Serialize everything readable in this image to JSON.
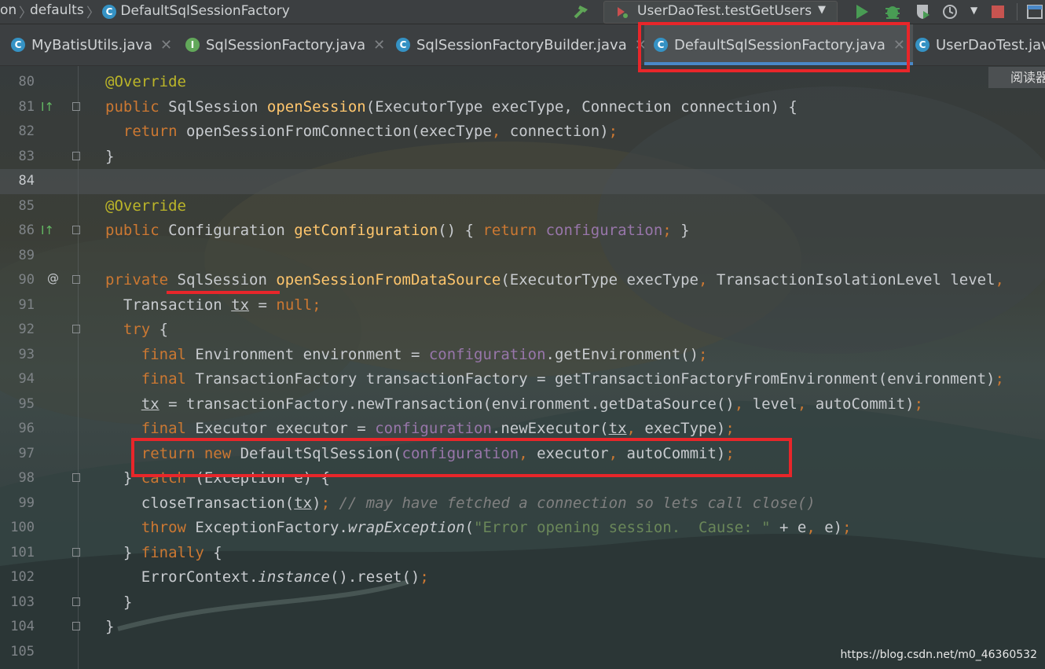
{
  "navbar": {
    "crumb_prefix": "on",
    "crumb_package": "defaults",
    "crumb_class": "DefaultSqlSessionFactory",
    "run_config": "UserDaoTest.testGetUsers"
  },
  "tabs": [
    {
      "label": "MyBatisUtils.java",
      "icon": "C"
    },
    {
      "label": "SqlSessionFactory.java",
      "icon": "I"
    },
    {
      "label": "SqlSessionFactoryBuilder.java",
      "icon": "C"
    },
    {
      "label": "DefaultSqlSessionFactory.java",
      "icon": "C"
    },
    {
      "label": "UserDaoTest.java",
      "icon": "C"
    }
  ],
  "reader_button": "阅读器",
  "editor": {
    "line_numbers": [
      "80",
      "81",
      "82",
      "83",
      "84",
      "85",
      "86",
      "89",
      "90",
      "91",
      "92",
      "93",
      "94",
      "95",
      "96",
      "97",
      "98",
      "99",
      "100",
      "101",
      "102",
      "103",
      "104",
      "105"
    ],
    "gutter_marks": {
      "81": "I↑",
      "86": "I↑",
      "90": "@"
    }
  },
  "watermark": "https://blog.csdn.net/m0_46360532",
  "colors": {
    "keyword": "#cc7832",
    "annotation": "#bbb529",
    "method": "#ffc66d",
    "field": "#9876aa",
    "string": "#6a8759",
    "comment": "#808080",
    "highlight_box": "#e8262a",
    "active_tab_underline": "#4a88c7"
  }
}
